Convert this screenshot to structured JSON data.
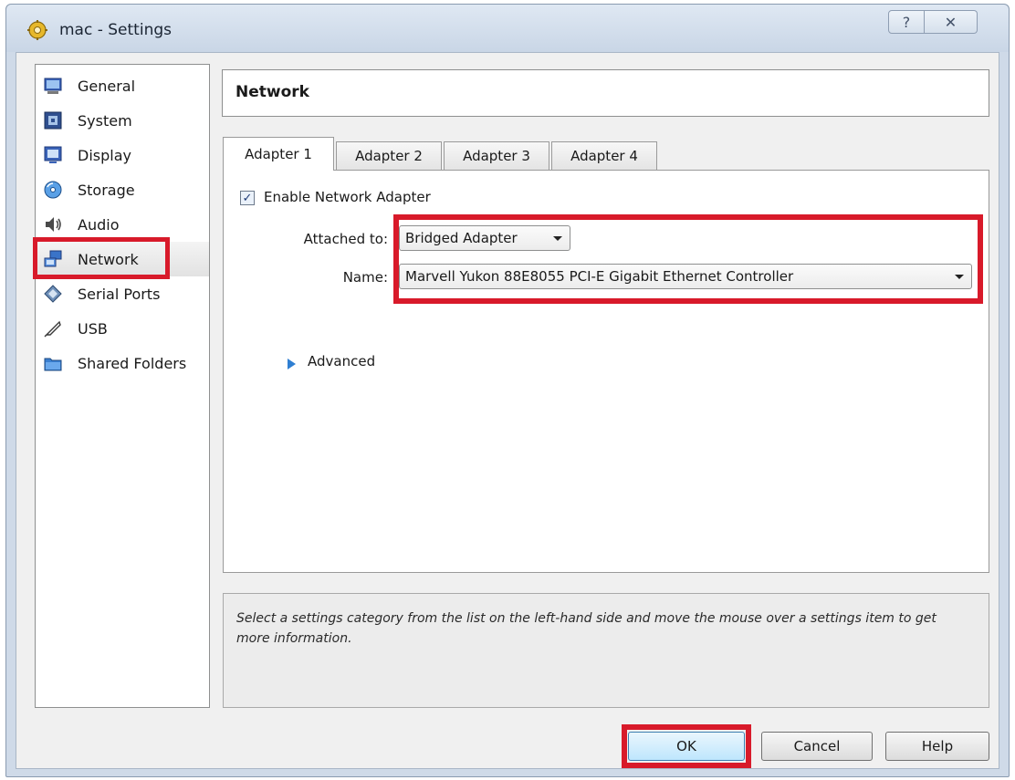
{
  "window": {
    "title": "mac - Settings",
    "help_button": "?",
    "close_button": "✕"
  },
  "sidebar": {
    "items": [
      {
        "label": "General",
        "icon": "general-icon"
      },
      {
        "label": "System",
        "icon": "system-icon"
      },
      {
        "label": "Display",
        "icon": "display-icon"
      },
      {
        "label": "Storage",
        "icon": "storage-icon"
      },
      {
        "label": "Audio",
        "icon": "audio-icon"
      },
      {
        "label": "Network",
        "icon": "network-icon",
        "selected": true
      },
      {
        "label": "Serial Ports",
        "icon": "serial-ports-icon"
      },
      {
        "label": "USB",
        "icon": "usb-icon"
      },
      {
        "label": "Shared Folders",
        "icon": "shared-folders-icon"
      }
    ]
  },
  "page": {
    "title": "Network"
  },
  "tabs": [
    "Adapter 1",
    "Adapter 2",
    "Adapter 3",
    "Adapter 4"
  ],
  "active_tab": "Adapter 1",
  "adapter": {
    "enable_label": "Enable Network Adapter",
    "enabled": true,
    "attached_label": "Attached to:",
    "attached_value": "Bridged Adapter",
    "name_label": "Name:",
    "name_value": "Marvell Yukon 88E8055 PCI-E Gigabit Ethernet Controller",
    "advanced_label": "Advanced"
  },
  "info": {
    "text": "Select a settings category from the list on the left-hand side and move the mouse over a settings item to get more information."
  },
  "buttons": {
    "ok": "OK",
    "cancel": "Cancel",
    "help": "Help"
  },
  "colors": {
    "highlight": "#d81a2a",
    "accent": "#2f7fd2"
  }
}
